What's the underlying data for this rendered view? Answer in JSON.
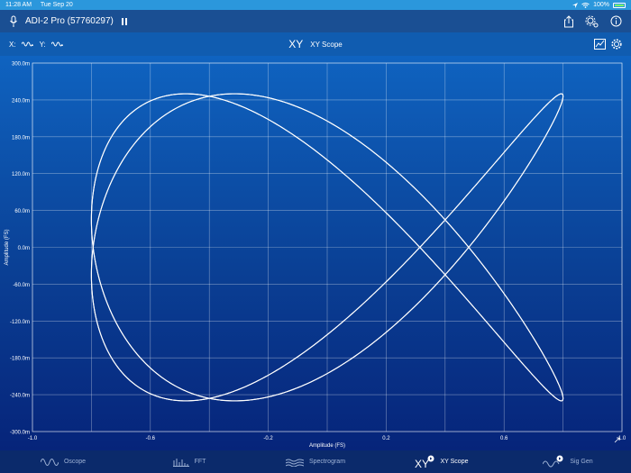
{
  "status_bar": {
    "time": "11:28 AM",
    "date": "Tue Sep 20",
    "battery": "100%"
  },
  "nav": {
    "device": "ADI-2 Pro (57760297)"
  },
  "toolbar": {
    "x_label": "X:",
    "y_label": "Y:",
    "mode_glyph": "XY",
    "title": "XY Scope"
  },
  "chart_data": {
    "type": "line",
    "xlabel": "Amplitude (FS)",
    "ylabel": "Amplitude (FS)",
    "xlim": [
      -1.0,
      1.0
    ],
    "ylim": [
      -0.3,
      0.3
    ],
    "x_ticks": [
      -1.0,
      -0.6,
      -0.2,
      0.2,
      0.6,
      1.0
    ],
    "x_tick_labels": [
      "-1.0",
      "-0.6",
      "-0.2",
      "0.2",
      "0.6",
      "1.0"
    ],
    "y_ticks": [
      0.3,
      0.24,
      0.18,
      0.12,
      0.06,
      0,
      -0.06,
      -0.12,
      -0.18,
      -0.24,
      -0.3
    ],
    "y_tick_labels": [
      "300.0m",
      "240.0m",
      "180.0m",
      "120.0m",
      "60.0m",
      "0.0m",
      "-60.0m",
      "-120.0m",
      "-180.0m",
      "-240.0m",
      "-300.0m"
    ],
    "grid": true,
    "series": [
      {
        "curve": "lissajous",
        "freq_x": 2,
        "freq_y": 3,
        "amp_x": 0.8,
        "amp_y": 0.25,
        "phase": 0.12
      },
      {
        "curve": "lissajous",
        "freq_x": 2,
        "freq_y": 3,
        "amp_x": 0.8,
        "amp_y": 0.25,
        "phase": -0.12
      }
    ]
  },
  "tabs": [
    {
      "label": "Oscope",
      "icon": "oscope-wave-icon",
      "active": false
    },
    {
      "label": "FFT",
      "icon": "fft-bars-icon",
      "active": false
    },
    {
      "label": "Spectrogram",
      "icon": "spectrogram-icon",
      "active": false
    },
    {
      "label": "XY Scope",
      "icon": "xy-icon",
      "active": true
    },
    {
      "label": "Sig Gen",
      "icon": "sig-gen-icon",
      "active": false
    }
  ]
}
